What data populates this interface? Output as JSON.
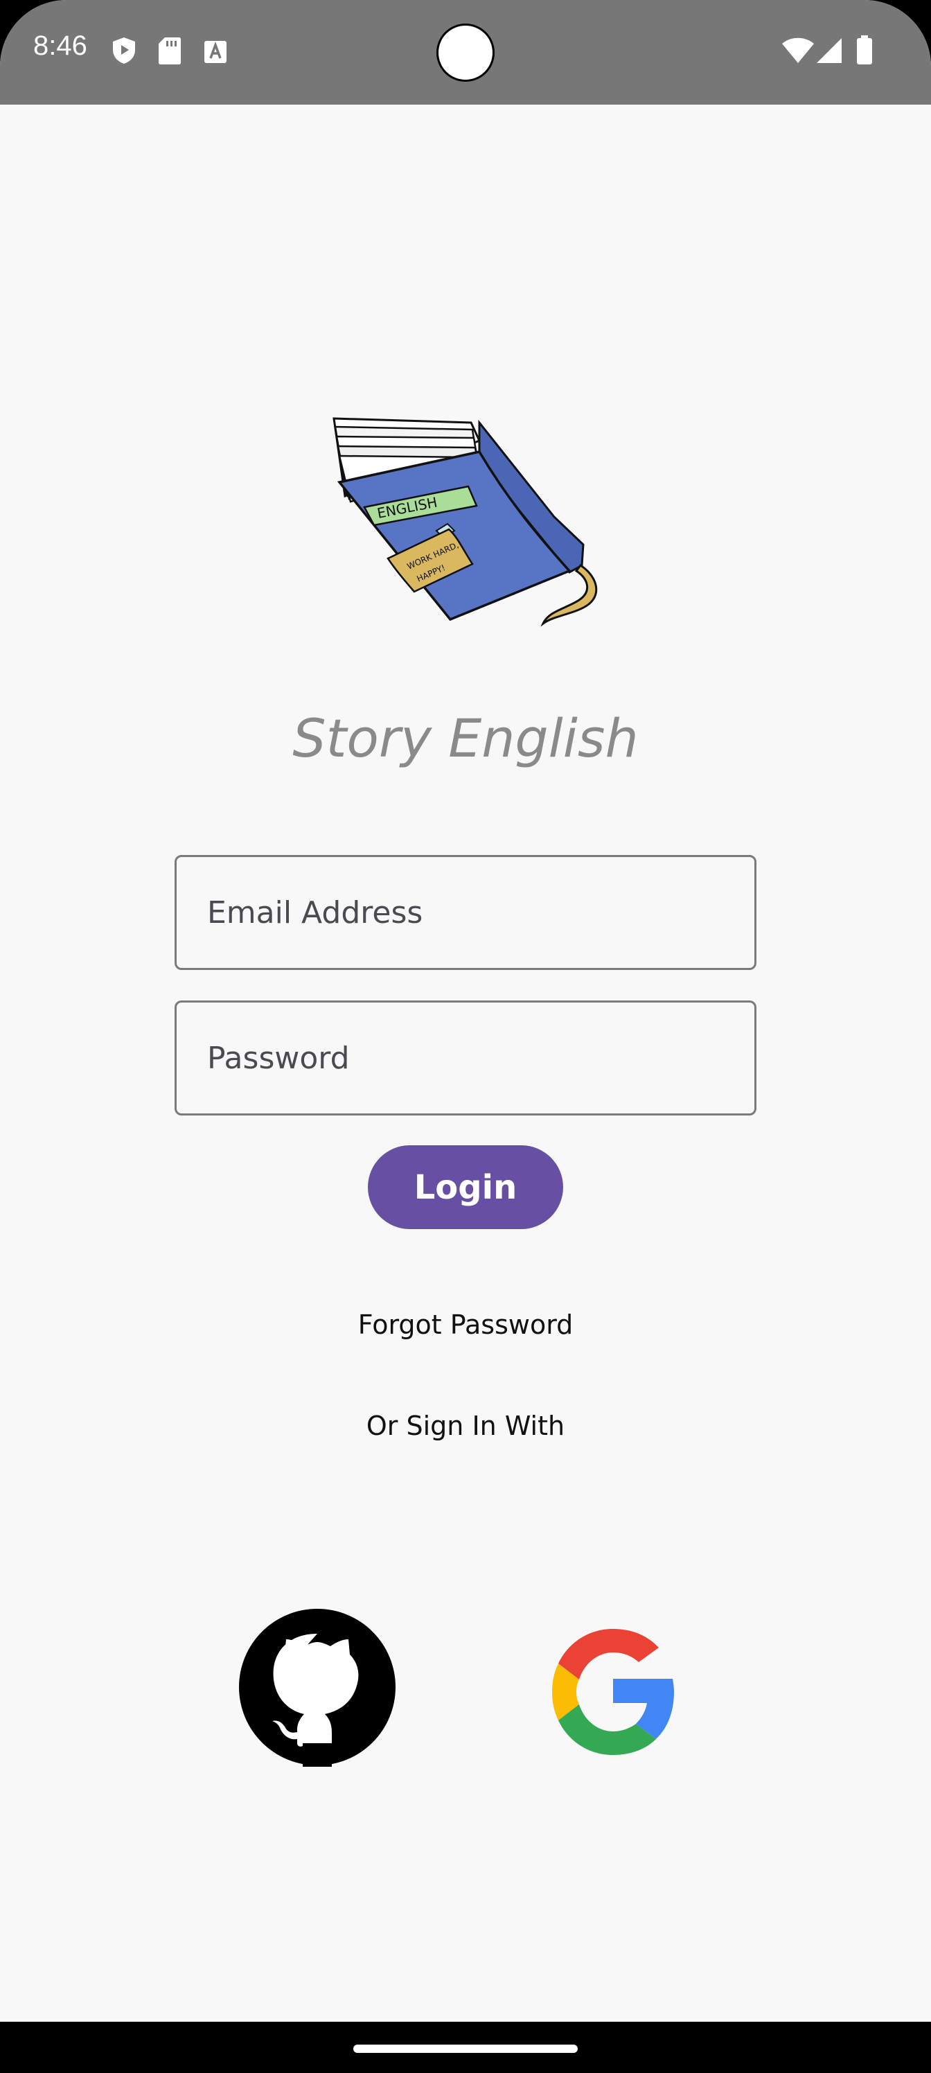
{
  "status_bar": {
    "time": "8:46",
    "left_icons": [
      "shield-play-icon",
      "sd-card-icon",
      "keyboard-a-icon"
    ],
    "right_icons": [
      "wifi-icon",
      "signal-icon",
      "battery-icon"
    ]
  },
  "logo": {
    "icon": "english-book-icon",
    "book_label": "ENGLISH",
    "note_text": "WORK HARD, HAPPY!"
  },
  "app_title": "Story English",
  "form": {
    "email_placeholder": "Email Address",
    "email_value": "",
    "password_placeholder": "Password",
    "password_value": "",
    "login_label": "Login"
  },
  "forgot_password_label": "Forgot Password",
  "social_caption": "Or Sign In With",
  "social_buttons": [
    {
      "icon": "github-icon"
    },
    {
      "icon": "google-icon"
    }
  ],
  "colors": {
    "status_bar": "#777777",
    "background": "#f8f8f8",
    "primary": "#6750a4",
    "title": "#8a8a8a",
    "book_blue": "#5874c4",
    "google_red": "#ea4335",
    "google_yellow": "#fbbc05",
    "google_green": "#34a853",
    "google_blue": "#4285f4"
  }
}
